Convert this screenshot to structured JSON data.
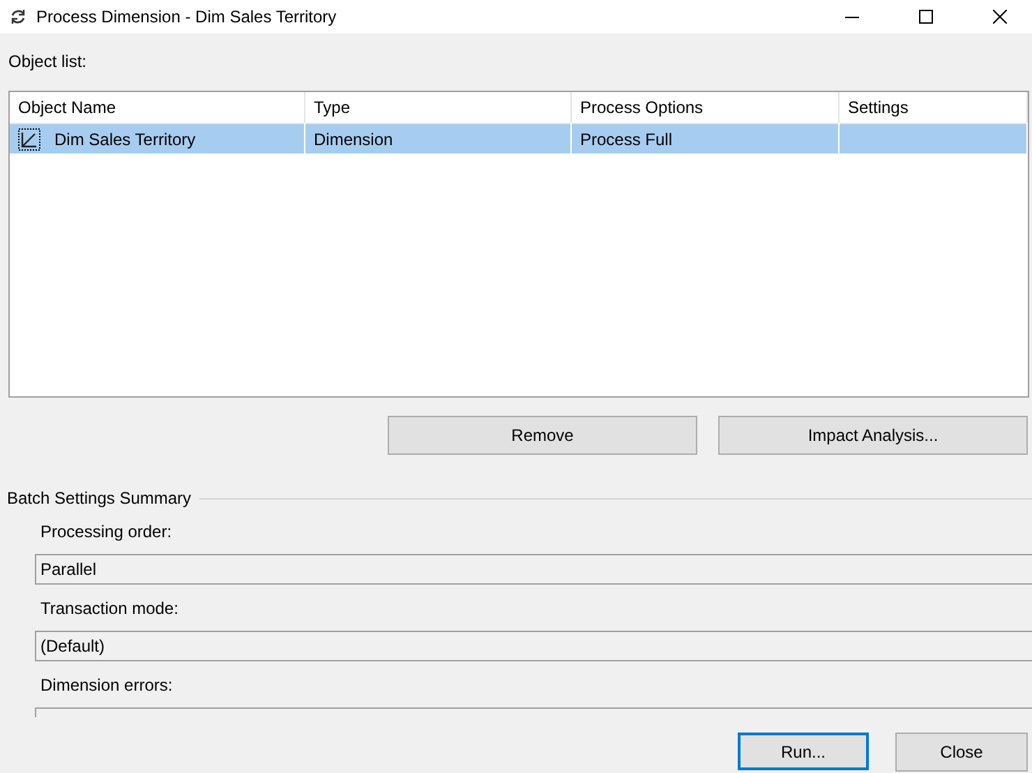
{
  "window": {
    "title": "Process Dimension - Dim Sales Territory"
  },
  "object_list": {
    "label": "Object list:",
    "columns": [
      "Object Name",
      "Type",
      "Process Options",
      "Settings"
    ],
    "rows": [
      {
        "selected": true,
        "cells": [
          "Dim Sales Territory",
          "Dimension",
          "Process Full",
          ""
        ]
      }
    ]
  },
  "list_buttons": [
    "Remove",
    "Impact Analysis..."
  ],
  "batch_settings": {
    "title": "Batch Settings Summary",
    "fields": [
      {
        "label": "Processing order:",
        "value": "Parallel"
      },
      {
        "label": "Transaction mode:",
        "value": "(Default)"
      },
      {
        "label": "Dimension errors:"
      }
    ]
  },
  "footer_buttons": [
    {
      "label": "Run...",
      "default": true
    },
    {
      "label": "Close",
      "default": false
    }
  ]
}
